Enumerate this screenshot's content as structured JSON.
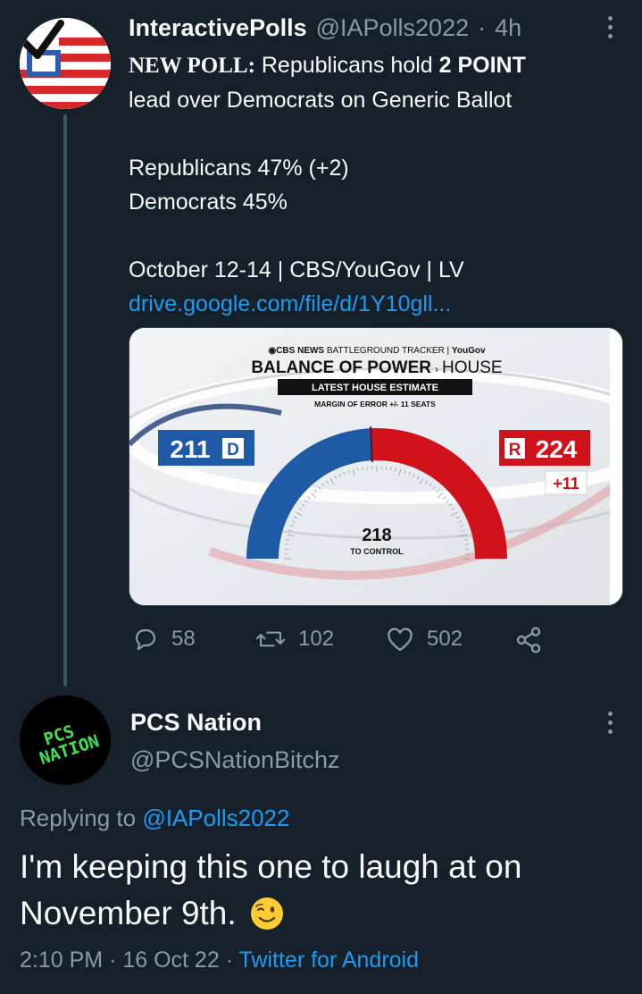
{
  "tweet": {
    "author_name": "InteractivePolls",
    "author_handle": "@IAPolls2022",
    "separator": "·",
    "age": "4h",
    "line1_lead": "NEW POLL:",
    "line1_mid": " Republicans hold ",
    "line1_bold": "2 POINT",
    "line2": "lead over Democrats on Generic Ballot",
    "line3": "Republicans 47% (+2)",
    "line4": "Democrats 45%",
    "line5": "October 12-14 | CBS/YouGov | LV",
    "link": "drive.google.com/file/d/1Y10gll...",
    "image": {
      "brand_line_a": "◉CBS NEWS",
      "brand_line_b": " BATTLEGROUND TRACKER | ",
      "brand_line_c": "YouGov",
      "title_bold": "BALANCE OF POWER",
      "title_arrow": "›",
      "title_light": "HOUSE",
      "banner": "LATEST HOUSE ESTIMATE",
      "margin": "MARGIN OF ERROR +/- 11 SEATS",
      "dem_seats": "211",
      "dem_letter": "D",
      "rep_letter": "R",
      "rep_seats": "224",
      "rep_change": "+11",
      "control_number": "218",
      "control_label": "TO CONTROL",
      "dem_color": "#1f5aa6",
      "rep_color": "#d0121b",
      "dem_share": 0.485,
      "rep_share": 0.515
    },
    "replies": "58",
    "retweets": "102",
    "likes": "502"
  },
  "reply": {
    "author_name": "PCS Nation",
    "author_handle": "@PCSNationBitchz",
    "avatar_text_1": "PCS",
    "avatar_text_2": "NATION",
    "replying_label": "Replying to ",
    "replying_handle": "@IAPolls2022",
    "text_line1": "I'm keeping this one to laugh at on",
    "text_line2": "November 9th.",
    "emoji": "wink-emoji",
    "time": "2:10 PM",
    "date": "16 Oct 22",
    "client": "Twitter for Android",
    "sep": "·"
  },
  "icons": {
    "reply": "reply-icon",
    "retweet": "retweet-icon",
    "like": "heart-icon",
    "share": "share-icon",
    "more": "more-icon"
  },
  "colors": {
    "background": "#15202b",
    "text": "#f7f9f9",
    "secondary": "#8b98a5",
    "link": "#1d9bf0",
    "thread_line": "#3d5466",
    "avatar2_text": "#3ee24f"
  }
}
